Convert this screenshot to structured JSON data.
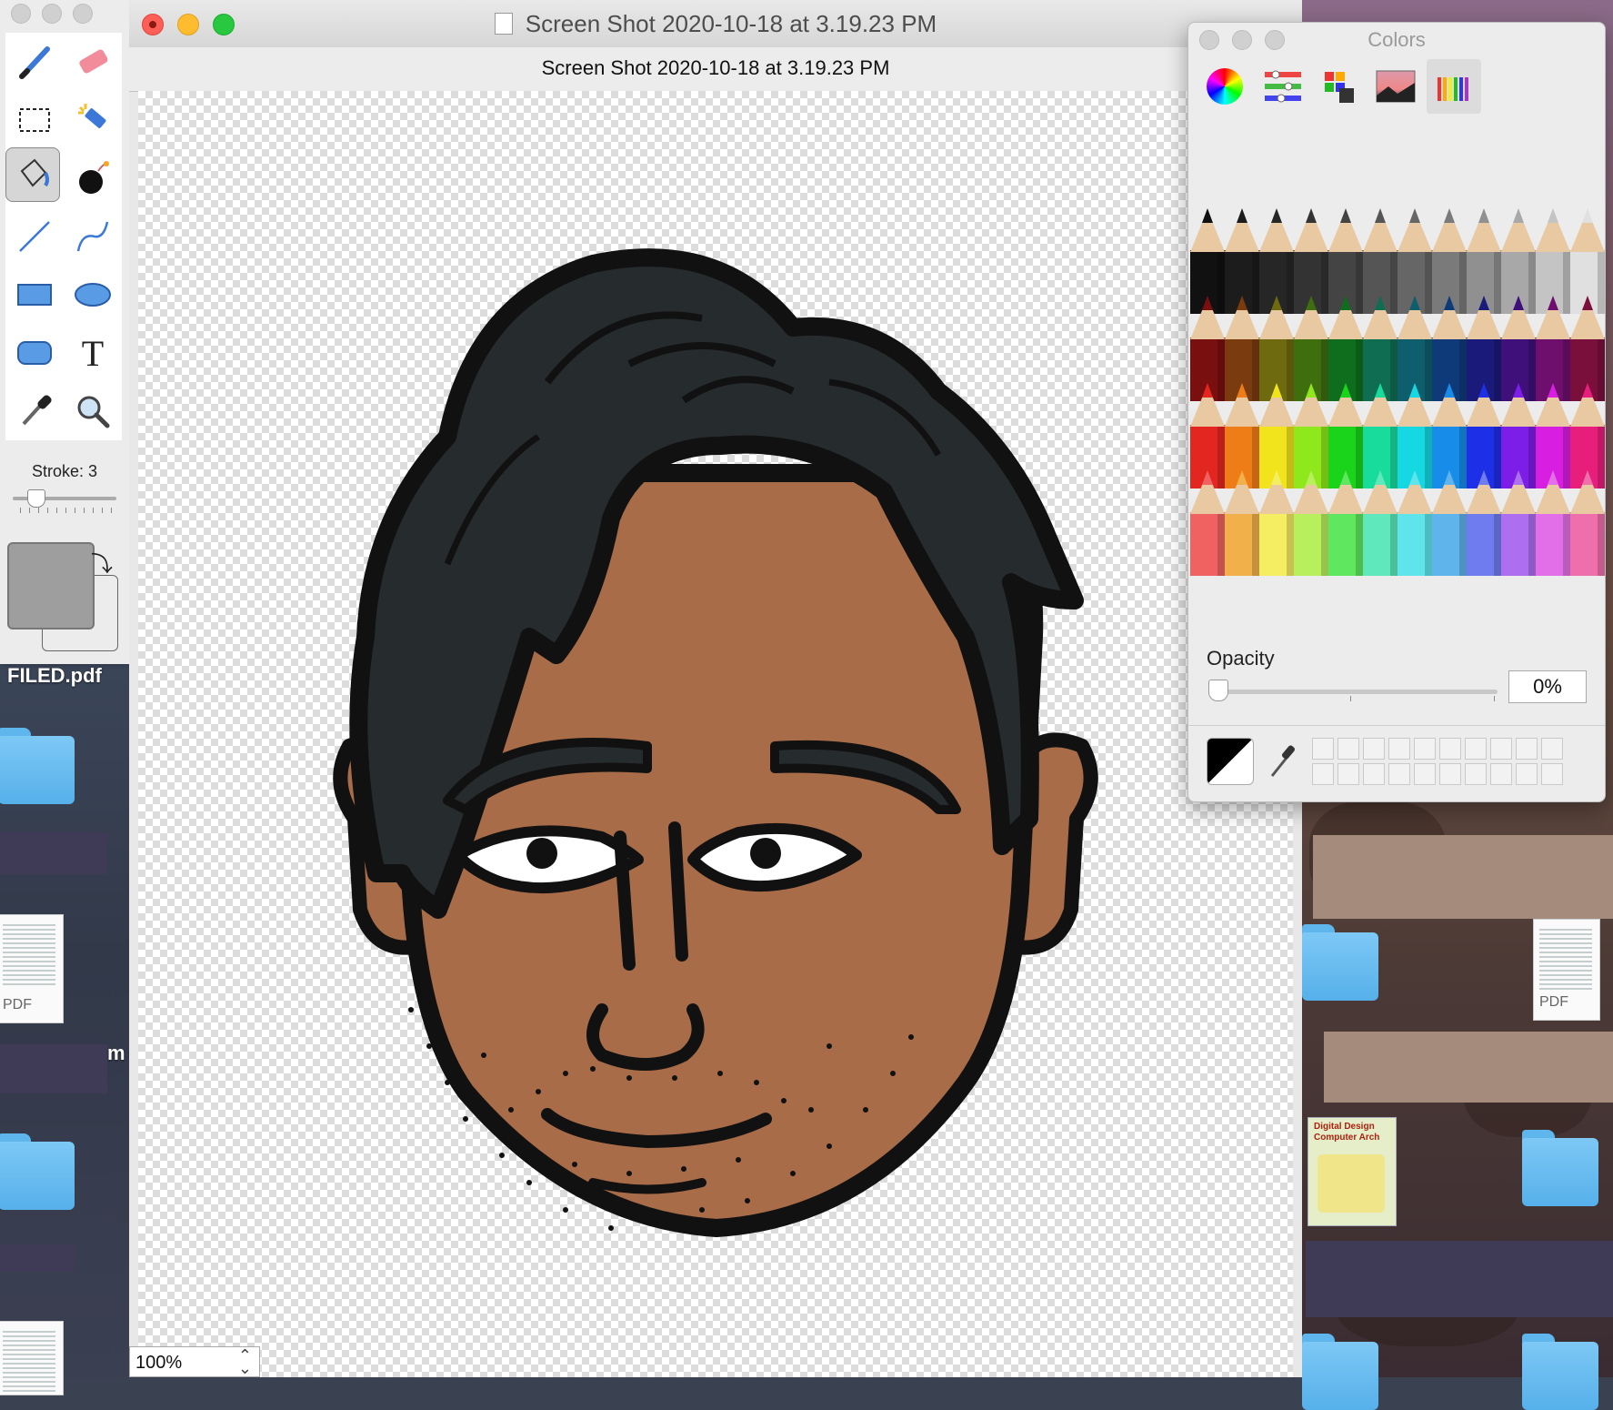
{
  "window": {
    "title": "Screen Shot 2020-10-18 at 3.19.23 PM",
    "subtitle": "Screen Shot 2020-10-18 at 3.19.23 PM",
    "zoom": "100%"
  },
  "tools": {
    "stroke_label": "Stroke: 3",
    "stroke_value": 3,
    "items": [
      "brush-tool",
      "eraser-tool",
      "rectangular-selection-tool",
      "magic-wand-tool",
      "paint-bucket-tool",
      "bomb-tool",
      "line-tool",
      "curve-tool",
      "rectangle-tool",
      "oval-tool",
      "rounded-rectangle-tool",
      "text-tool",
      "eyedropper-tool",
      "magnifier-tool"
    ],
    "selected": "paint-bucket-tool",
    "text_tool_glyph": "T"
  },
  "colors_panel": {
    "title": "Colors",
    "tabs": [
      "color-wheel",
      "color-sliders",
      "color-palettes",
      "image-palettes",
      "pencils"
    ],
    "active_tab": "pencils",
    "opacity_label": "Opacity",
    "opacity_value": "0%",
    "current_color": "#000000"
  },
  "pencils": {
    "rows": [
      [
        "#111111",
        "#1c1c1c",
        "#262626",
        "#333333",
        "#444444",
        "#555555",
        "#666666",
        "#7a7a7a",
        "#909090",
        "#a8a8a8",
        "#c4c4c4",
        "#e0e0e0"
      ],
      [
        "#7a0f0f",
        "#7a3c0f",
        "#6e6a0f",
        "#3f6e0f",
        "#0f6e1e",
        "#0f6e52",
        "#0f5e6e",
        "#0f3a7a",
        "#1a1a7a",
        "#3f0f7a",
        "#6e0f6e",
        "#7a0f3c"
      ],
      [
        "#e3261f",
        "#ef7d17",
        "#f2e41c",
        "#8fe81b",
        "#19d41b",
        "#18dc9b",
        "#16d8e2",
        "#178ce8",
        "#1e2fe8",
        "#7d1ee8",
        "#d81ee0",
        "#e81e7d"
      ],
      [
        "#f06262",
        "#f2b04a",
        "#f5ee63",
        "#b7f05c",
        "#5fe85f",
        "#5fe8bc",
        "#5fe4ec",
        "#5fb4ec",
        "#6f7cef",
        "#ad6fef",
        "#e36fe8",
        "#ef6fad"
      ]
    ]
  },
  "desktop": {
    "file_label": "FILED.pdf",
    "pdf_label": "PDF",
    "pdf_label_right": "PDF",
    "partial_letter": "m",
    "book_title_line1": "Digital Design",
    "book_title_line2": "Computer Arch"
  }
}
